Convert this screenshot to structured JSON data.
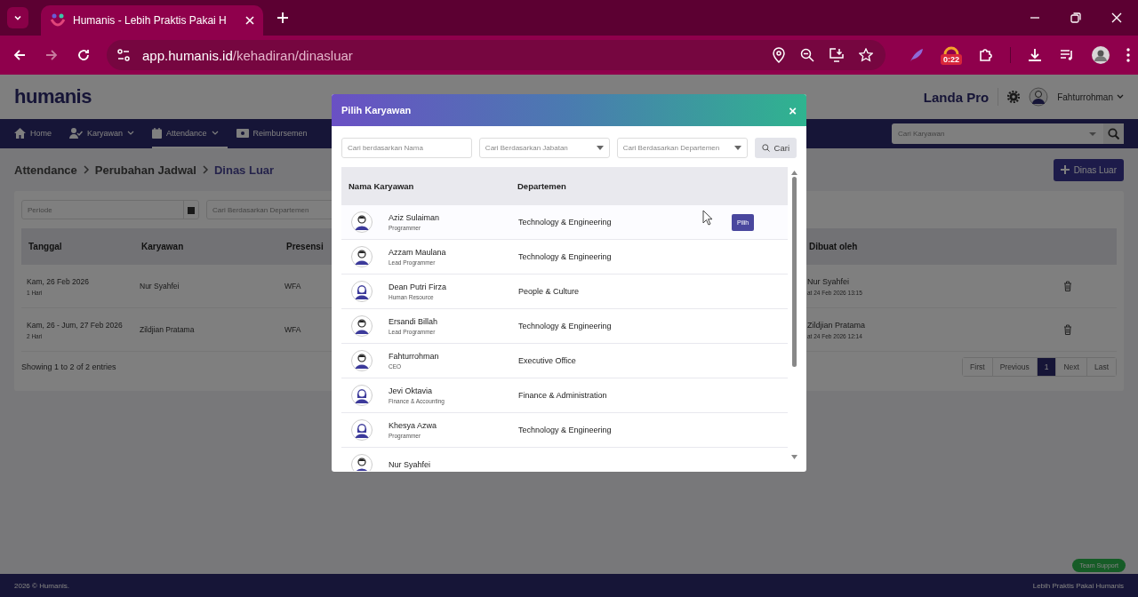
{
  "browser": {
    "tab_title": "Humanis - Lebih Praktis Pakai H",
    "url_host": "app.humanis.id",
    "url_path": "/kehadiran/dinasluar",
    "extension_badge": "0:22"
  },
  "header": {
    "logo": "humanis",
    "company": "Landa Pro",
    "user": "Fahturrohman"
  },
  "nav": {
    "items": [
      {
        "label": "Home",
        "kind": "home",
        "selected": false
      },
      {
        "label": "Karyawan",
        "kind": "user",
        "selected": false,
        "dropdown": true
      },
      {
        "label": "Attendance",
        "kind": "calendar",
        "selected": true,
        "dropdown": true
      },
      {
        "label": "Reimbursemen",
        "kind": "money",
        "selected": false
      }
    ],
    "search_placeholder": "Cari Karyawan"
  },
  "breadcrumb": [
    {
      "label": "Attendance",
      "current": false
    },
    {
      "label": "Perubahan Jadwal",
      "current": false
    },
    {
      "label": "Dinas Luar",
      "current": true
    }
  ],
  "add_button": "Dinas Luar",
  "filters": {
    "period_placeholder": "Periode",
    "department_placeholder": "Cari Berdasarkan Departemen"
  },
  "table": {
    "columns": [
      "Tanggal",
      "Karyawan",
      "Presensi",
      "Dibuat oleh"
    ],
    "rows": [
      {
        "date": "Kam, 26 Feb 2026",
        "duration": "1 Hari",
        "employee": "Nur Syahfei",
        "presence": "WFA",
        "created_by": "Nur Syahfei",
        "created_at": "at 24 Feb 2026 13:15"
      },
      {
        "date": "Kam, 26 - Jum, 27 Feb 2026",
        "duration": "2 Hari",
        "employee": "Zildjian Pratama",
        "presence": "WFA",
        "created_by": "Zildjian Pratama",
        "created_at": "at 24 Feb 2026 12:14"
      }
    ],
    "info": "Showing 1 to 2 of 2 entries",
    "pagination": [
      {
        "label": "First",
        "selected": false
      },
      {
        "label": "Previous",
        "selected": false
      },
      {
        "label": "1",
        "selected": true
      },
      {
        "label": "Next",
        "selected": false
      },
      {
        "label": "Last",
        "selected": false
      }
    ]
  },
  "footer": {
    "copyright": "2026 © Humanis.",
    "tagline": "Lebih Praktis Pakai Humanis",
    "support": "Team Support"
  },
  "modal": {
    "title": "Pilih Karyawan",
    "close": "×",
    "name_placeholder": "Cari berdasarkan Nama",
    "position_placeholder": "Cari Berdasarkan Jabatan",
    "department_placeholder": "Cari Berdasarkan Departemen",
    "search_button": "Cari",
    "columns": [
      "Nama Karyawan",
      "Departemen"
    ],
    "pick_button": "Pilih",
    "rows": [
      {
        "name": "Aziz Sulaiman",
        "position": "Programmer",
        "department": "Technology & Engineering",
        "kind": "male",
        "hovered": true
      },
      {
        "name": "Azzam Maulana",
        "position": "Lead Programmer",
        "department": "Technology & Engineering",
        "kind": "male",
        "hovered": false
      },
      {
        "name": "Dean Putri Firza",
        "position": "Human Resource",
        "department": "People & Culture",
        "kind": "female",
        "hovered": false
      },
      {
        "name": "Ersandi Billah",
        "position": "Lead Programmer",
        "department": "Technology & Engineering",
        "kind": "male",
        "hovered": false
      },
      {
        "name": "Fahturrohman",
        "position": "CEO",
        "department": "Executive Office",
        "kind": "male",
        "hovered": false
      },
      {
        "name": "Jevi Oktavia",
        "position": "Finance & Accounting",
        "department": "Finance & Administration",
        "kind": "female",
        "hovered": false
      },
      {
        "name": "Khesya Azwa",
        "position": "Programmer",
        "department": "Technology & Engineering",
        "kind": "female",
        "hovered": false
      },
      {
        "name": "Nur Syahfei",
        "kind": "male",
        "hovered": false
      }
    ]
  }
}
